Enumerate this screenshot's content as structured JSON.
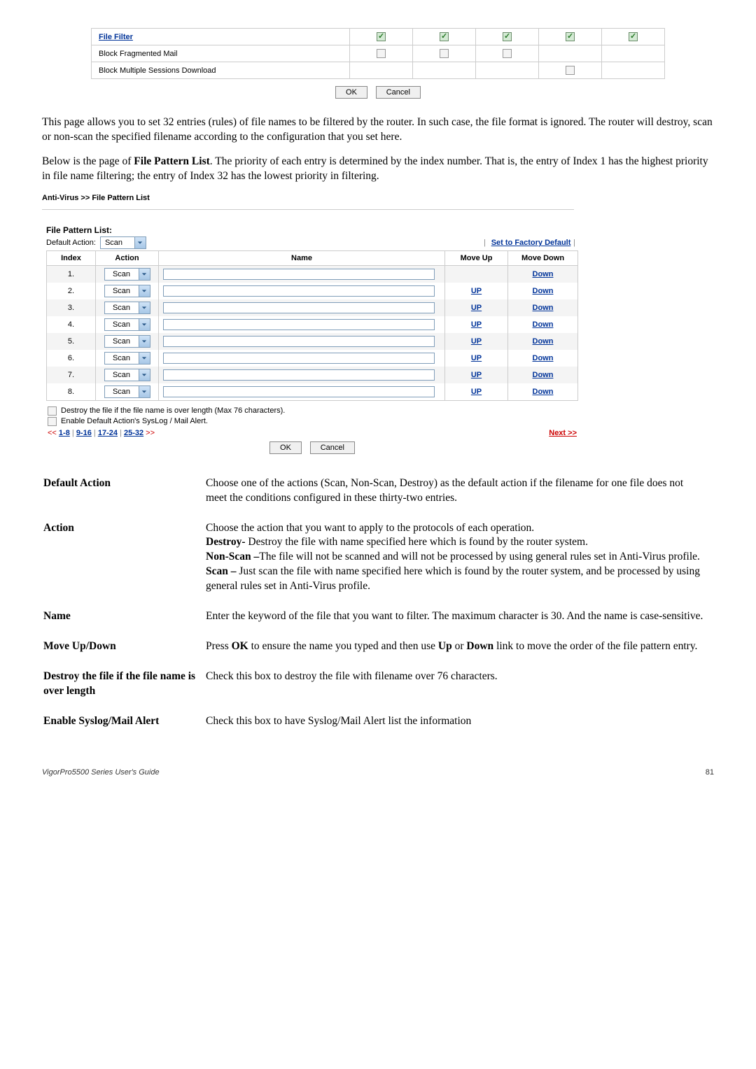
{
  "top_table": {
    "rows": [
      {
        "label": "File Filter",
        "is_link": true,
        "checks": [
          "green",
          "green",
          "green",
          "green",
          "green"
        ]
      },
      {
        "label": "Block Fragmented Mail",
        "is_link": false,
        "checks": [
          "gray",
          "gray",
          "gray",
          "none",
          "none"
        ]
      },
      {
        "label": "Block Multiple Sessions Download",
        "is_link": false,
        "checks": [
          "none",
          "none",
          "none",
          "gray",
          "none"
        ]
      }
    ],
    "ok": "OK",
    "cancel": "Cancel"
  },
  "para1": "This page allows you to set 32 entries (rules) of file names to be filtered by the router. In such case, the file format is ignored. The router will destroy, scan or non-scan the specified filename according to the configuration that you set here.",
  "para2_pre": "Below is the page of ",
  "para2_bold": "File Pattern List",
  "para2_post": ". The priority of each entry is determined by the index number. That is, the entry of Index 1 has the highest priority in file name filtering; the entry of Index 32 has the lowest priority in filtering.",
  "breadcrumb": "Anti-Virus >> File Pattern List",
  "fpl": {
    "title": "File Pattern List:",
    "default_action_label": "Default Action:",
    "default_action_value": "Scan",
    "factory_link": "Set to Factory Default",
    "headers": {
      "index": "Index",
      "action": "Action",
      "name": "Name",
      "move_up": "Move Up",
      "move_down": "Move Down"
    },
    "rows": [
      {
        "index": "1.",
        "action": "Scan",
        "up": "",
        "down": "Down",
        "alt": true
      },
      {
        "index": "2.",
        "action": "Scan",
        "up": "UP",
        "down": "Down",
        "alt": false
      },
      {
        "index": "3.",
        "action": "Scan",
        "up": "UP",
        "down": "Down",
        "alt": true
      },
      {
        "index": "4.",
        "action": "Scan",
        "up": "UP",
        "down": "Down",
        "alt": false
      },
      {
        "index": "5.",
        "action": "Scan",
        "up": "UP",
        "down": "Down",
        "alt": true
      },
      {
        "index": "6.",
        "action": "Scan",
        "up": "UP",
        "down": "Down",
        "alt": false
      },
      {
        "index": "7.",
        "action": "Scan",
        "up": "UP",
        "down": "Down",
        "alt": true
      },
      {
        "index": "8.",
        "action": "Scan",
        "up": "UP",
        "down": "Down",
        "alt": false
      }
    ],
    "destroy_cb": "Destroy the file if the file name is over length (Max 76 characters).",
    "enable_cb": "Enable Default Action's SysLog / Mail Alert.",
    "pager": {
      "lprev": "<<",
      "p1": "1-8",
      "p2": "9-16",
      "p3": "17-24",
      "p4": "25-32",
      "rnext": ">>",
      "next_label": "Next >>"
    },
    "ok": "OK",
    "cancel": "Cancel"
  },
  "defs": {
    "default_action": {
      "term": "Default Action",
      "body": "Choose one of the actions (Scan, Non-Scan, Destroy) as the default action if the filename for one file does not meet the conditions configured in these thirty-two entries."
    },
    "action": {
      "term": "Action",
      "l1": "Choose the action that you want to apply to the protocols of each operation.",
      "l2a": "Destroy-",
      "l2b": " Destroy the file with name specified here which is found by the router system.",
      "l3a": "Non-Scan –",
      "l3b": "The file will not be scanned and will not be processed by using general rules set in Anti-Virus profile.",
      "l4a": "Scan –",
      "l4b": " Just scan the file with name specified here which is found by the router system, and be processed by using general rules set in Anti-Virus profile."
    },
    "name": {
      "term": "Name",
      "body": "Enter the keyword of the file that you want to filter. The maximum character is 30. And the name is case-sensitive."
    },
    "moveupdown": {
      "term": "Move Up/Down",
      "pre": "Press ",
      "b1": "OK",
      "mid": " to ensure the name you typed and then use ",
      "b2": "Up",
      "mid2": " or ",
      "b3": "Down",
      "post": " link to move the order of the file pattern entry."
    },
    "destroy": {
      "term": "Destroy the file if the file name is over length",
      "body": "Check this box to destroy the file with filename over 76 characters."
    },
    "syslog": {
      "term": "Enable Syslog/Mail Alert",
      "body": "Check this box to have Syslog/Mail Alert list the information"
    }
  },
  "footer": {
    "guide": "VigorPro5500 Series User's Guide",
    "page": "81"
  }
}
